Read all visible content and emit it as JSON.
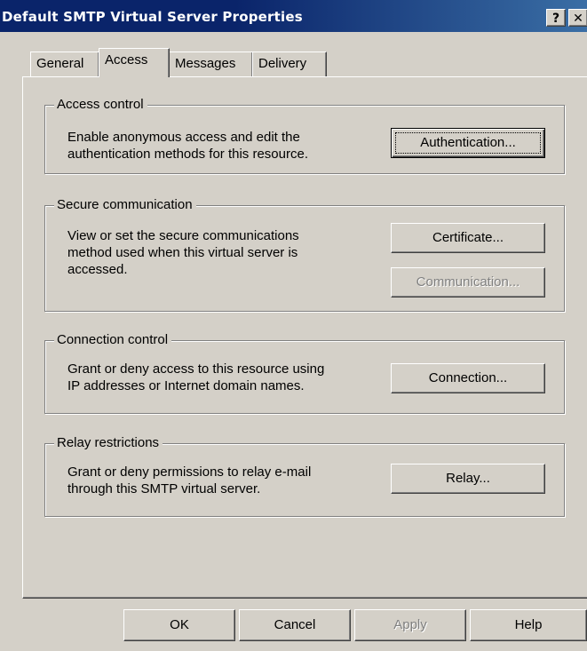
{
  "window": {
    "title": "Default SMTP Virtual Server Properties",
    "help_glyph": "?",
    "close_glyph": "✕"
  },
  "tabs": [
    {
      "label": "General",
      "active": false
    },
    {
      "label": "Access",
      "active": true
    },
    {
      "label": "Messages",
      "active": false
    },
    {
      "label": "Delivery",
      "active": false
    }
  ],
  "groups": {
    "access_control": {
      "legend": "Access control",
      "desc_line1": "Enable anonymous access and edit the",
      "desc_line2": "authentication methods for this resource.",
      "button": "Authentication..."
    },
    "secure_communication": {
      "legend": "Secure communication",
      "desc_line1": "View or set the secure communications",
      "desc_line2": "method used when this virtual server is",
      "desc_line3": "accessed.",
      "button_certificate": "Certificate...",
      "button_communication": "Communication..."
    },
    "connection_control": {
      "legend": "Connection control",
      "desc_line1": "Grant or deny access to this resource using",
      "desc_line2": "IP addresses or Internet domain names.",
      "button": "Connection..."
    },
    "relay_restrictions": {
      "legend": "Relay restrictions",
      "desc_line1": "Grant or deny permissions to relay e-mail",
      "desc_line2": "through this SMTP virtual server.",
      "button": "Relay..."
    }
  },
  "footer": {
    "ok": "OK",
    "cancel": "Cancel",
    "apply": "Apply",
    "help": "Help"
  },
  "colors": {
    "dialog_face": "#d4d0c8",
    "titlebar_start": "#0a246a",
    "titlebar_end": "#3a6ea5",
    "disabled_text": "#808080"
  }
}
